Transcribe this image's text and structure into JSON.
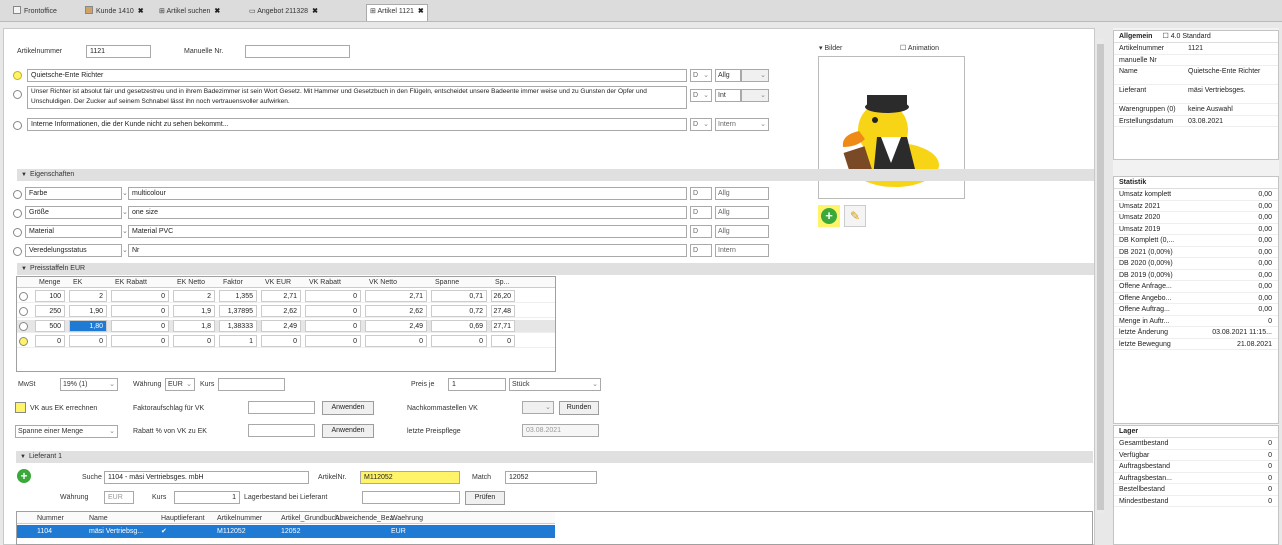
{
  "tabs": [
    {
      "label": "Frontoffice"
    },
    {
      "label": "Kunde 1410"
    },
    {
      "label": "Artikel suchen"
    },
    {
      "label": "Angebot 211328"
    },
    {
      "label": "Artikel 1121"
    }
  ],
  "header": {
    "artikelnummer_label": "Artikelnummer",
    "artikelnummer_value": "1121",
    "manuelle_label": "Manuelle Nr.",
    "manuelle_value": ""
  },
  "texts": {
    "name": "Quietsche-Ente Richter",
    "description": "Unser Richter ist absolut fair und gesetzestreu und in ihrem Badezimmer ist sein Wort Gesetz. Mit Hammer und Gesetzbuch in den Flügeln, entscheidet unsere Badeente immer weise und zu Gunsten der Opfer und Unschuldigen. Der Zucker auf seinem Schnabel lässt ihn noch vertrauensvoller aufwirken.",
    "internal": "Interne Informationen, die der Kunde nicht zu sehen bekommt...",
    "lang": "D",
    "tag1": "Allg",
    "tag2": "Int",
    "tag3": "Intern"
  },
  "image": {
    "bilder_label": "Bilder",
    "animation_label": "Animation"
  },
  "sections": {
    "allgemein": "Allgemein",
    "eigenschaften": "Eigenschaften",
    "preise": "Preisstaffeln EUR",
    "lieferant": "Lieferant 1"
  },
  "properties": [
    {
      "name": "Farbe",
      "value": "multicolour",
      "lang": "D",
      "tag": "Allg"
    },
    {
      "name": "Größe",
      "value": "one size",
      "lang": "D",
      "tag": "Allg"
    },
    {
      "name": "Material",
      "value": "Material PVC",
      "lang": "D",
      "tag": "Allg"
    },
    {
      "name": "Veredelungsstatus",
      "value": "Nr",
      "lang": "D",
      "tag": "Intern"
    }
  ],
  "price_grid": {
    "headers": [
      "Menge",
      "EK",
      "EK Rabatt",
      "EK Netto",
      "Faktor",
      "VK EUR",
      "VK Rabatt",
      "VK Netto",
      "Spanne",
      "Sp..."
    ],
    "rows": [
      [
        "100",
        "2",
        "0",
        "2",
        "1,355",
        "2,71",
        "0",
        "2,71",
        "0,71",
        "26,20"
      ],
      [
        "250",
        "1,90",
        "0",
        "1,9",
        "1,37895",
        "2,62",
        "0",
        "2,62",
        "0,72",
        "27,48"
      ],
      [
        "500",
        "1,80",
        "0",
        "1,8",
        "1,38333",
        "2,49",
        "0",
        "2,49",
        "0,69",
        "27,71"
      ],
      [
        "0",
        "0",
        "0",
        "0",
        "1",
        "0",
        "0",
        "0",
        "0",
        "0"
      ]
    ]
  },
  "pricing": {
    "mwst_label": "MwSt",
    "mwst_value": "19% (1)",
    "waehrung_label": "Währung",
    "waehrung_value": "EUR",
    "kurs_label": "Kurs",
    "preisje_label": "Preis je",
    "preisje_value": "1",
    "preisje_unit": "Stück",
    "vk_label": "VK aus EK errechnen",
    "faktor_label": "Faktoraufschlag für VK",
    "anwenden_label": "Anwenden",
    "nachkomma_label": "Nachkommastellen VK",
    "runden_label": "Runden",
    "spanne_label": "Spanne einer Menge",
    "rabatt_label": "Rabatt % von VK zu EK",
    "preispflege_label": "letzte Preispflege",
    "preispflege_value": "03.08.2021"
  },
  "lieferant": {
    "suche_label": "Suche",
    "suche_value": "1104 - mäsi Vertriebsges. mbH",
    "artikelnr_label": "ArtikelNr.",
    "artikelnr_value": "M112052",
    "matchcode_label": "Match",
    "matchcode_value": "12052",
    "waehrung_label": "Währung",
    "waehrung_value": "EUR",
    "kurs_label": "Kurs",
    "kurs_value": "1",
    "lager_label": "Lagerbestand bei Lieferant",
    "pruefen_label": "Prüfen",
    "grid_headers": [
      "Nummer",
      "Name",
      "Hauptlieferant",
      "Artikelnummer",
      "Artikel_Grundbuch",
      "Abweichende_Bez.",
      "Waehrung"
    ],
    "grid_row": [
      "1104",
      "mäsi Vertriebsg...",
      "✔",
      "M112052",
      "12052",
      "",
      "EUR"
    ]
  },
  "right": {
    "allg_title": "Allgemein",
    "std_label": "4.0 Standard",
    "allg_rows": [
      {
        "k": "Artikelnummer",
        "v": "1121"
      },
      {
        "k": "manuelle Nr",
        "v": ""
      },
      {
        "k": "Name",
        "v": "Quietsche-Ente Richter"
      },
      {
        "k": "Lieferant",
        "v": "mäsi Vertriebsges."
      },
      {
        "k": "Warengruppen (0)",
        "v": "keine Auswahl"
      },
      {
        "k": "Erstellungsdatum",
        "v": "03.08.2021"
      }
    ],
    "stat_title": "Statistik",
    "stat_rows": [
      {
        "k": "Umsatz komplett",
        "v": "0,00"
      },
      {
        "k": "Umsatz 2021",
        "v": "0,00"
      },
      {
        "k": "Umsatz 2020",
        "v": "0,00"
      },
      {
        "k": "Umsatz 2019",
        "v": "0,00"
      },
      {
        "k": "DB Komplett (0,...",
        "v": "0,00"
      },
      {
        "k": "DB 2021 (0,00%)",
        "v": "0,00"
      },
      {
        "k": "DB 2020 (0,00%)",
        "v": "0,00"
      },
      {
        "k": "DB 2019 (0,00%)",
        "v": "0,00"
      },
      {
        "k": "Offene Anfrage...",
        "v": "0,00"
      },
      {
        "k": "Offene Angebo...",
        "v": "0,00"
      },
      {
        "k": "Offene Auftrag...",
        "v": "0,00"
      },
      {
        "k": "Menge in Auftr...",
        "v": "0"
      },
      {
        "k": "letzte Änderung",
        "v": "03.08.2021 11:15..."
      },
      {
        "k": "letzte Bewegung",
        "v": "21.08.2021"
      }
    ],
    "lager_title": "Lager",
    "lager_rows": [
      {
        "k": "Gesamtbestand",
        "v": "0"
      },
      {
        "k": "Verfügbar",
        "v": "0"
      },
      {
        "k": "Auftragsbestand",
        "v": "0"
      },
      {
        "k": "Auftragsbestan...",
        "v": "0"
      },
      {
        "k": "Bestellbestand",
        "v": "0"
      },
      {
        "k": "Mindestbestand",
        "v": "0"
      }
    ]
  },
  "colors": {
    "highlight": "#fff36a",
    "selection": "#1e7ad3",
    "green": "#3aa93a"
  }
}
